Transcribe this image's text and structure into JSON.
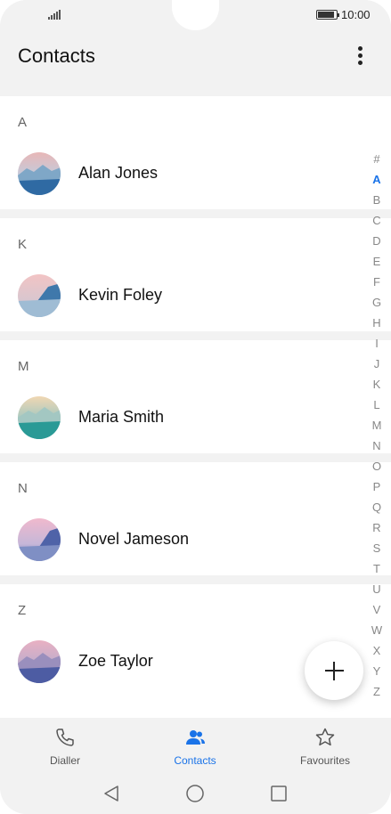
{
  "status_bar": {
    "time": "10:00"
  },
  "header": {
    "title": "Contacts",
    "more_icon": "more-vertical-icon"
  },
  "sections": [
    {
      "letter": "A",
      "contacts": [
        {
          "name": "Alan Jones",
          "avatar": "landscape-avatar"
        }
      ]
    },
    {
      "letter": "K",
      "contacts": [
        {
          "name": "Kevin Foley",
          "avatar": "landscape-avatar"
        }
      ]
    },
    {
      "letter": "M",
      "contacts": [
        {
          "name": "Maria Smith",
          "avatar": "landscape-avatar"
        }
      ]
    },
    {
      "letter": "N",
      "contacts": [
        {
          "name": "Novel Jameson",
          "avatar": "landscape-avatar"
        }
      ]
    },
    {
      "letter": "Z",
      "contacts": [
        {
          "name": "Zoe Taylor",
          "avatar": "landscape-avatar"
        }
      ]
    }
  ],
  "index_bar": {
    "letters": [
      "#",
      "A",
      "B",
      "C",
      "D",
      "E",
      "F",
      "G",
      "H",
      "I",
      "J",
      "K",
      "L",
      "M",
      "N",
      "O",
      "P",
      "Q",
      "R",
      "S",
      "T",
      "U",
      "V",
      "W",
      "X",
      "Y",
      "Z"
    ],
    "active": "A"
  },
  "fab": {
    "icon": "plus-icon"
  },
  "bottom_nav": {
    "items": [
      {
        "label": "Dialler",
        "icon": "phone-icon",
        "active": false
      },
      {
        "label": "Contacts",
        "icon": "contacts-icon",
        "active": true
      },
      {
        "label": "Favourites",
        "icon": "star-icon",
        "active": false
      }
    ]
  },
  "colors": {
    "accent": "#1a73e8",
    "background": "#f2f2f2",
    "card": "#ffffff"
  }
}
